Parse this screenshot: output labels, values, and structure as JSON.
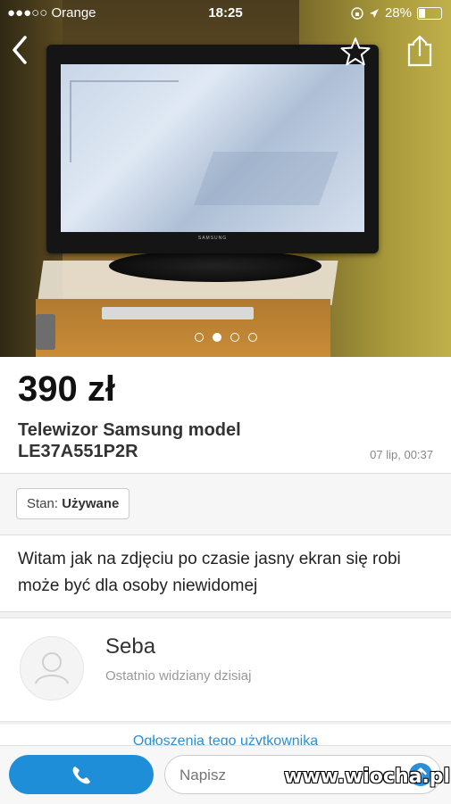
{
  "status_bar": {
    "carrier": "●●●○○ Orange",
    "time": "18:25",
    "battery": "28%",
    "battery_level": 0.28
  },
  "photo_carousel": {
    "tv_brand": "SAMSUNG",
    "total_images": 4,
    "active_index": 1
  },
  "listing": {
    "price": "390 zł",
    "title": "Telewizor Samsung model LE37A551P2R",
    "date": "07 lip, 00:37",
    "condition_label": "Stan:",
    "condition_value": "Używane",
    "description": "Witam jak na zdjęciu po czasie jasny ekran się robi może być dla osoby niewidomej"
  },
  "seller": {
    "name": "Seba",
    "status": "Ostatnio widziany dzisiaj",
    "ads_link": "Ogłoszenia tego użytkownika"
  },
  "bottom_bar": {
    "message_placeholder": "Napisz"
  },
  "colors": {
    "accent": "#1e8ed8"
  },
  "watermark": "www.wiocha.pl"
}
